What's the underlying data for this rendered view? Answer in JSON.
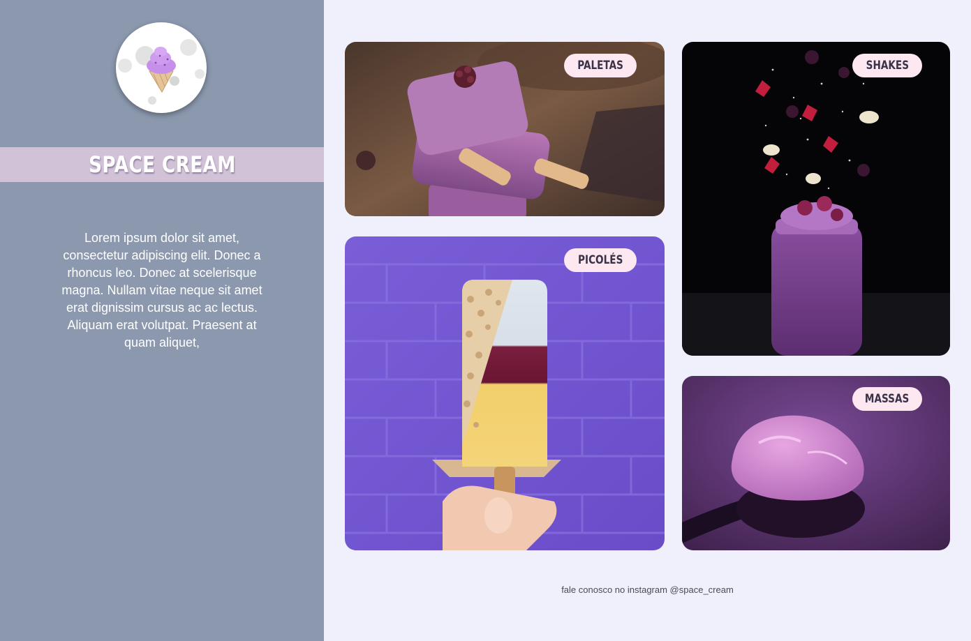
{
  "brand": {
    "name": "SPACE CREAM",
    "logo_icon": "ice-cream-cone-icon",
    "colors": {
      "sidebar": "#8b98ae",
      "title_band": "#d2c2d8",
      "page_background": "#f0f0fc",
      "label_pill": "#fde8f2"
    }
  },
  "sidebar": {
    "description": "Lorem ipsum dolor sit amet, consectetur adipiscing elit. Donec a rhoncus leo. Donec at scelerisque magna. Nullam vitae neque sit amet erat dignissim cursus ac ac lectus. Aliquam erat volutpat. Praesent at quam aliquet,"
  },
  "categories": [
    {
      "label": "PALETAS",
      "image": "stacked-purple-ice-pops-photo"
    },
    {
      "label": "PICOLÉS",
      "image": "popsicle-in-hand-purple-brick-wall-photo"
    },
    {
      "label": "SHAKES",
      "image": "berry-shake-jar-falling-fruit-photo"
    },
    {
      "label": "MASSAS",
      "image": "purple-ice-cream-spoon-photo"
    }
  ],
  "footer": {
    "text": "fale conosco no instagram @space_cream"
  }
}
